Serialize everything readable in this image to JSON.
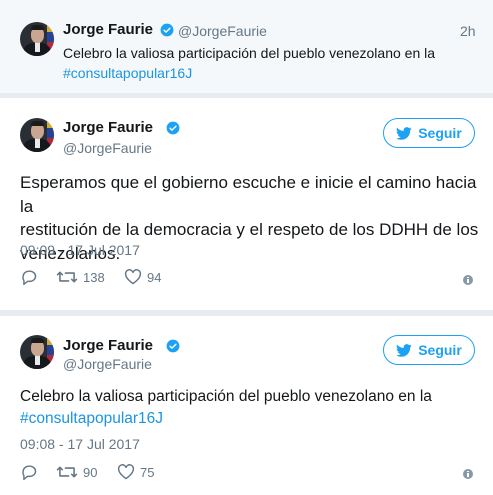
{
  "top_tweet": {
    "name": "Jorge Faurie",
    "handle": "@JorgeFaurie",
    "time_ago": "2h",
    "text_line1": "Celebro la valiosa participación del pueblo venezolano en la",
    "hashtag": "#consultapopular16J"
  },
  "tweet1": {
    "name": "Jorge Faurie",
    "handle": "@JorgeFaurie",
    "follow_label": "Seguir",
    "text_line1": "Esperamos que el gobierno escuche e inicie el camino hacia la",
    "text_line2": "restitución de la democracia y el respeto de los DDHH de los",
    "text_line3": "venezolanos.",
    "date": "09:09 - 17 Jul 2017",
    "retweets": "138",
    "likes": "94"
  },
  "tweet2": {
    "name": "Jorge Faurie",
    "handle": "@JorgeFaurie",
    "follow_label": "Seguir",
    "text_line1": "Celebro la valiosa participación del pueblo venezolano en la",
    "hashtag": "#consultapopular16J",
    "date": "09:08 - 17 Jul 2017",
    "retweets": "90",
    "likes": "75"
  },
  "colors": {
    "accent": "#1da1f2",
    "link": "#1b95e0",
    "muted": "#657786",
    "background": "#e6ecf0"
  },
  "icons": [
    "verified-badge-icon",
    "twitter-bird-icon",
    "reply-icon",
    "retweet-icon",
    "like-heart-icon",
    "info-icon"
  ]
}
